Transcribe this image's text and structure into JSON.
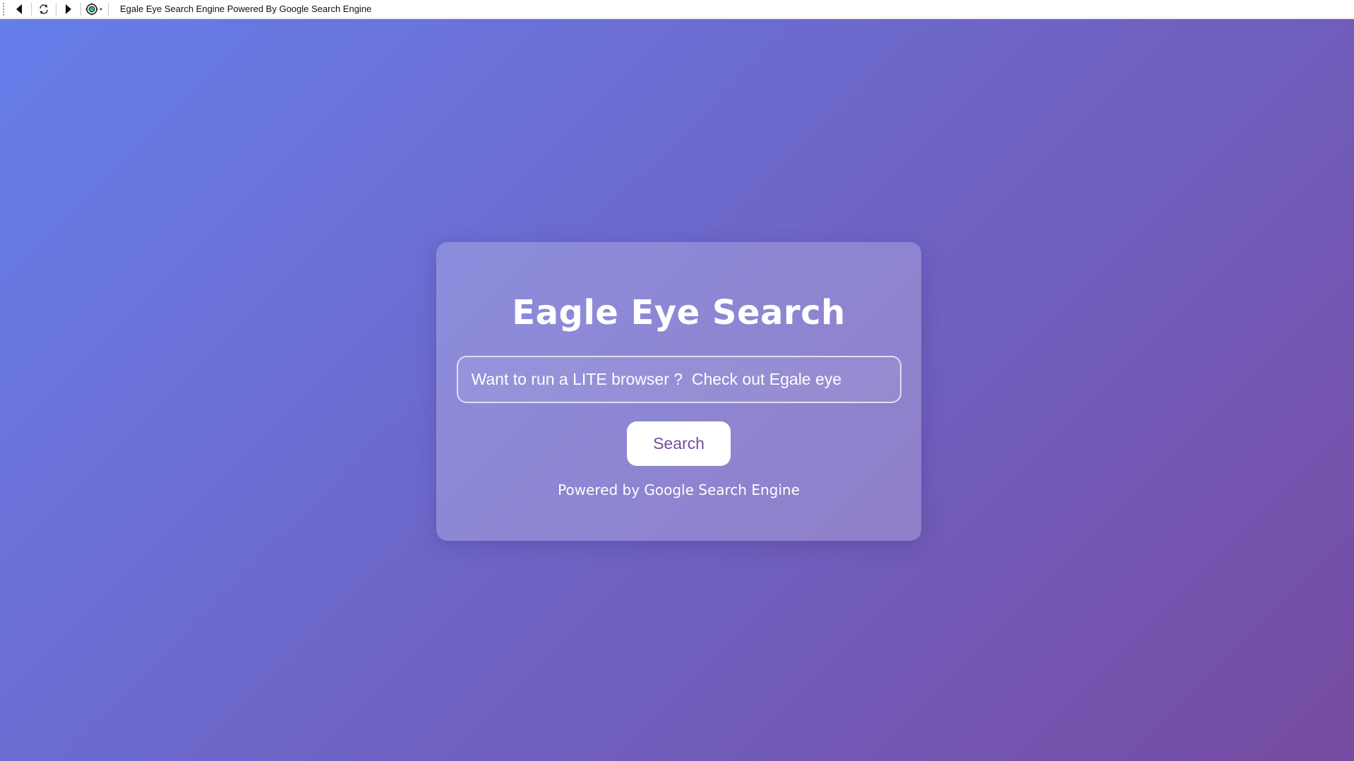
{
  "window": {
    "title": "Egale Eye Search Engine Powered By Google Search Engine"
  },
  "toolbar": {
    "back_icon": "back-arrow-icon",
    "refresh_icon": "refresh-icon",
    "forward_icon": "forward-arrow-icon",
    "settings_icon": "gear-dropdown-icon"
  },
  "search_card": {
    "title": "Eagle Eye Search",
    "search_input": {
      "value": "",
      "placeholder": "Want to run a LITE browser ?  Check out Egale eye"
    },
    "search_button_label": "Search",
    "footer_text": "Powered by Google Search Engine"
  },
  "colors": {
    "gradient_start": "#667eea",
    "gradient_end": "#764ba2",
    "button_text": "#764ba2",
    "text": "#ffffff"
  }
}
